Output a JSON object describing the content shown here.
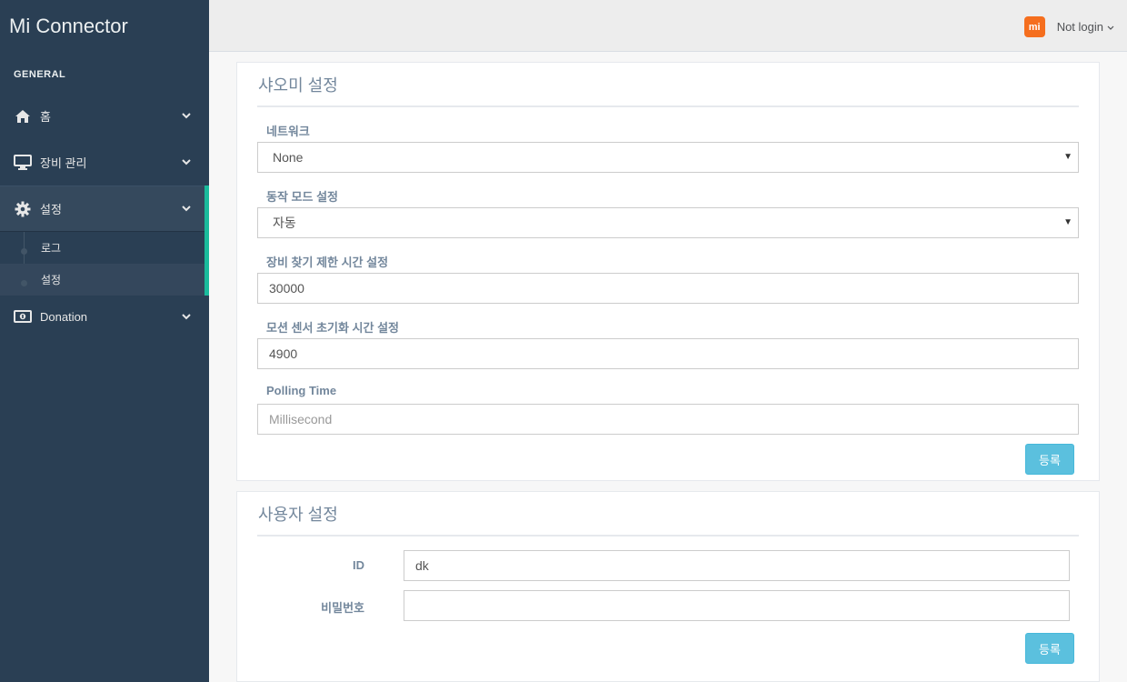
{
  "sidebar": {
    "brand": "Mi Connector",
    "section_title": "GENERAL",
    "items": [
      {
        "label": "홈",
        "icon": "home-icon"
      },
      {
        "label": "장비 관리",
        "icon": "monitor-icon"
      },
      {
        "label": "설정",
        "icon": "gear-icon"
      },
      {
        "label": "Donation",
        "icon": "money-icon"
      }
    ],
    "submenu": [
      {
        "label": "로그"
      },
      {
        "label": "설정"
      }
    ]
  },
  "topnav": {
    "logo_text": "mi",
    "user_label": "Not login",
    "accent_color": "#F56E1E"
  },
  "xiaomi_panel": {
    "title": "샤오미 설정",
    "fields": {
      "network_label": "네트워크",
      "network_value": "None",
      "mode_label": "동작 모드 설정",
      "mode_value": "자동",
      "search_label": "장비 찾기 제한 시간 설정",
      "search_value": "30000",
      "motion_label": "모션 센서 초기화 시간 설정",
      "motion_value": "4900",
      "polling_label": "Polling Time",
      "polling_placeholder": "Millisecond"
    },
    "submit_label": "등록"
  },
  "user_panel": {
    "title": "사용자 설정",
    "id_label": "ID",
    "id_value": "dk",
    "password_label": "비밀번호",
    "password_value": "",
    "submit_label": "등록"
  },
  "colors": {
    "sidebar_bg": "#2A3F54",
    "active_border": "#1ABB9C",
    "button_info": "#5BC0DE"
  }
}
